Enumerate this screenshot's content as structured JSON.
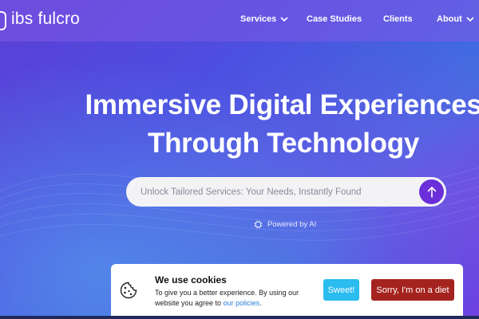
{
  "brand": {
    "logo_text": "ibs fulcro"
  },
  "nav": {
    "items": [
      {
        "label": "Services",
        "has_dropdown": true
      },
      {
        "label": "Case Studies",
        "has_dropdown": false
      },
      {
        "label": "Clients",
        "has_dropdown": false
      },
      {
        "label": "About",
        "has_dropdown": true
      }
    ]
  },
  "hero": {
    "title_line1": "Immersive Digital Experiences",
    "title_line2": "Through Technology"
  },
  "search": {
    "placeholder": "Unlock Tailored Services: Your Needs, Instantly Found",
    "value": "",
    "submit_icon": "arrow-up-icon"
  },
  "powered": {
    "label": "Powered by AI",
    "icon": "chip-icon"
  },
  "cookie": {
    "title": "We use cookies",
    "text": "To give you a better experience. By using our website you agree to ",
    "link_text": "our policies",
    "text_end": ".",
    "accept_label": "Sweet!",
    "decline_label": "Sorry, I'm on a diet",
    "icon": "cookie-icon"
  },
  "colors": {
    "accent": "#6a2fd9",
    "accept": "#2bbcf0",
    "decline": "#a5231e",
    "link": "#2b7cd8"
  }
}
